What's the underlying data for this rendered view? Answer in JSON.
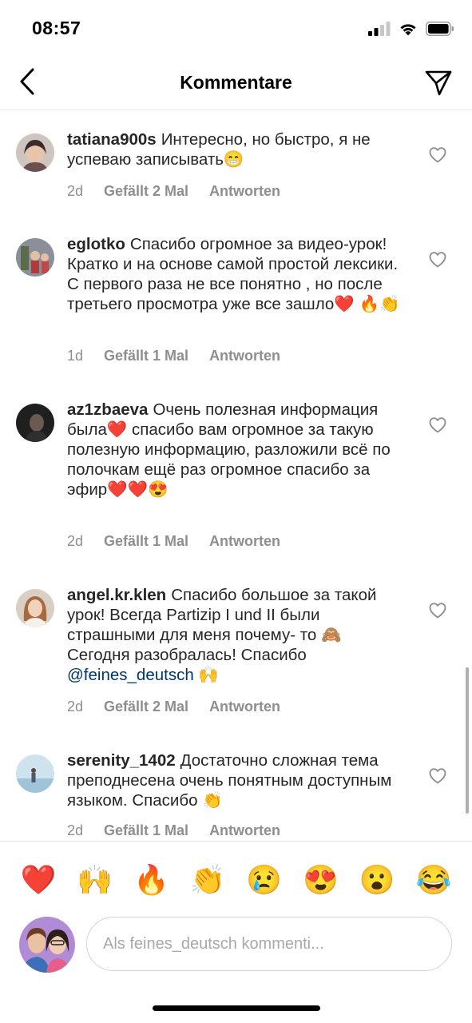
{
  "status_bar": {
    "time": "08:57",
    "icons": [
      "signal-icon",
      "wifi-icon",
      "battery-icon"
    ]
  },
  "header": {
    "title": "Kommentare",
    "back_icon": "chevron-left-icon",
    "share_icon": "paper-plane-icon"
  },
  "comments": [
    {
      "username": "tatiana900s",
      "text": "Интересно, но быстро, я не успеваю записывать😁",
      "age": "2d",
      "likes": "Gefällt 2 Mal",
      "reply": "Antworten"
    },
    {
      "username": "eglotko",
      "text": "Спасибо огромное за видео-урок! Кратко и на основе самой простой лексики. С первого раза не все понятно , но после третьего просмотра уже все зашло❤️ 🔥👏",
      "age": "1d",
      "likes": "Gefällt 1 Mal",
      "reply": "Antworten"
    },
    {
      "username": "az1zbaeva",
      "text": "Очень полезная информация была❤️ спасибо вам огромное за такую полезную информацию, разложили всё по полочкам ещё раз огромное спасибо за эфир❤️❤️😍",
      "age": "2d",
      "likes": "Gefällt 1 Mal",
      "reply": "Antworten"
    },
    {
      "username": "angel.kr.klen",
      "text_before": "Спасибо большое за такой урок! Всегда Partizip I und II были страшными для меня почему- то 🙈 Сегодня разобралась! Спасибо ",
      "mention": "@feines_deutsch",
      "text_after": " 🙌",
      "age": "2d",
      "likes": "Gefällt 2 Mal",
      "reply": "Antworten"
    },
    {
      "username": "serenity_1402",
      "text": "Достаточно сложная тема преподнесена очень понятным доступным языком. Спасибо 👏",
      "age": "2d",
      "likes": "Gefällt 1 Mal",
      "reply": "Antworten"
    }
  ],
  "emoji_bar": [
    "❤️",
    "🙌",
    "🔥",
    "👏",
    "😢",
    "😍",
    "😮",
    "😂"
  ],
  "composer": {
    "placeholder": "Als feines_deutsch kommenti..."
  },
  "colors": {
    "text": "#262626",
    "secondary": "#8e8e8e",
    "mention": "#00376b",
    "divider": "#e6e6e6"
  }
}
